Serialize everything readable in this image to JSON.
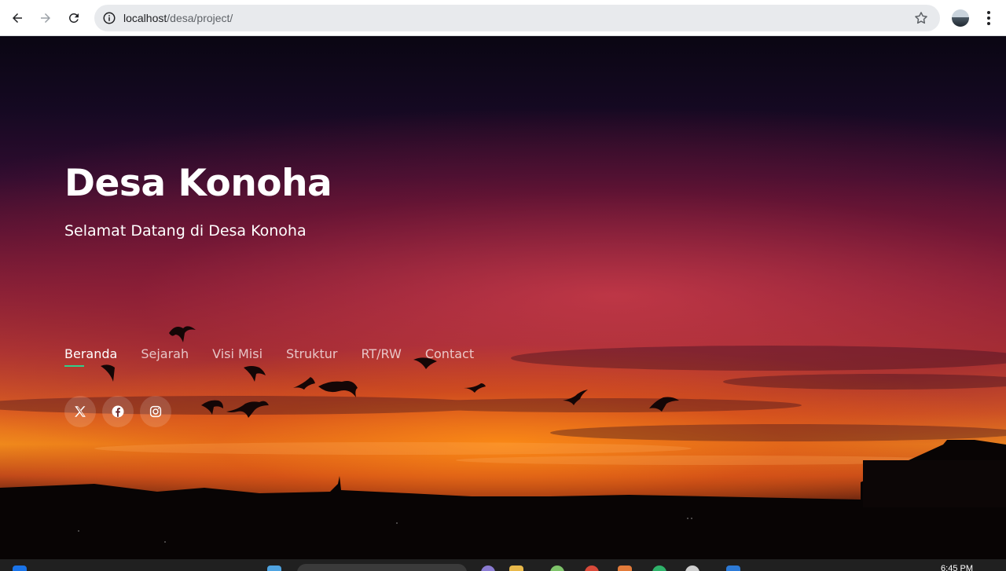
{
  "browser": {
    "url_host": "localhost",
    "url_path": "/desa/project/",
    "icons": {
      "back": "arrow-left-icon",
      "forward": "arrow-right-icon",
      "reload": "reload-icon",
      "site_info": "info-icon",
      "bookmark": "star-icon",
      "menu": "kebab-menu-icon"
    }
  },
  "hero": {
    "title": "Desa Konoha",
    "subtitle": "Selamat Datang di Desa Konoha"
  },
  "nav": {
    "items": [
      {
        "label": "Beranda",
        "active": true
      },
      {
        "label": "Sejarah",
        "active": false
      },
      {
        "label": "Visi Misi",
        "active": false
      },
      {
        "label": "Struktur",
        "active": false
      },
      {
        "label": "RT/RW",
        "active": false
      },
      {
        "label": "Contact",
        "active": false
      }
    ]
  },
  "social": [
    "x-twitter-icon",
    "facebook-icon",
    "instagram-icon"
  ],
  "taskbar": {
    "clock": "6:45 PM"
  },
  "colors": {
    "accent": "#2fd08b",
    "chrome_bg": "#ffffff",
    "omnibox_bg": "#e8eaed"
  }
}
